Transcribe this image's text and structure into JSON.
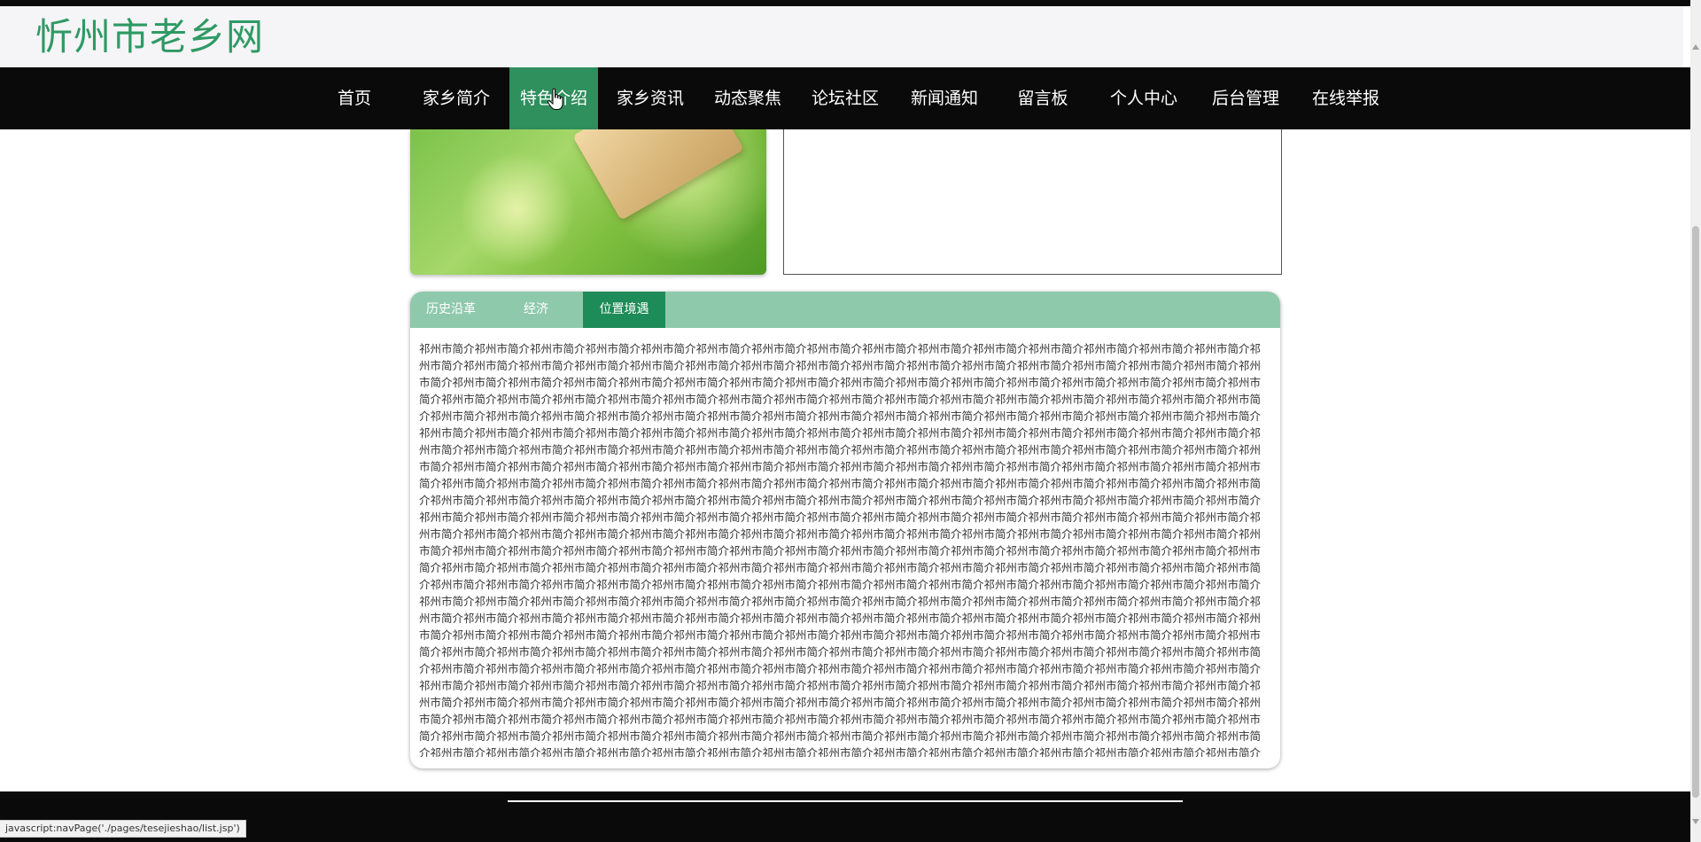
{
  "site": {
    "title": "忻州市老乡网"
  },
  "nav": {
    "items": [
      {
        "label": "首页"
      },
      {
        "label": "家乡简介"
      },
      {
        "label": "特色介绍"
      },
      {
        "label": "家乡资讯"
      },
      {
        "label": "动态聚焦"
      },
      {
        "label": "论坛社区"
      },
      {
        "label": "新闻通知"
      },
      {
        "label": "留言板"
      },
      {
        "label": "个人中心"
      },
      {
        "label": "后台管理"
      },
      {
        "label": "在线举报"
      }
    ],
    "active_label": "特色介绍"
  },
  "tabs": {
    "items": [
      {
        "label": "历史沿革"
      },
      {
        "label": "经济"
      },
      {
        "label": "位置境遇"
      }
    ],
    "active_label": "位置境遇",
    "content": "祁州市简介祁州市简介祁州市简介祁州市简介祁州市简介祁州市简介祁州市简介祁州市简介祁州市简介祁州市简介祁州市简介祁州市简介祁州市简介祁州市简介祁州市简介祁州市简介祁州市简介祁州市简介祁州市简介祁州市简介祁州市简介祁州市简介祁州市简介祁州市简介祁州市简介祁州市简介祁州市简介祁州市简介祁州市简介祁州市简介祁州市简介祁州市简介祁州市简介祁州市简介祁州市简介祁州市简介祁州市简介祁州市简介祁州市简介祁州市简介祁州市简介祁州市简介祁州市简介祁州市简介祁州市简介祁州市简介祁州市简介祁州市简介祁州市简介祁州市简介祁州市简介祁州市简介祁州市简介祁州市简介祁州市简介祁州市简介祁州市简介祁州市简介祁州市简介祁州市简介祁州市简介祁州市简介祁州市简介祁州市简介祁州市简介祁州市简介祁州市简介祁州市简介祁州市简介祁州市简介祁州市简介祁州市简介祁州市简介祁州市简介祁州市简介祁州市简介祁州市简介祁州市简介祁州市简介祁州市简介祁州市简介祁州市简介祁州市简介祁州市简介祁州市简介祁州市简介祁州市简介祁州市简介祁州市简介祁州市简介祁州市简介祁州市简介祁州市简介祁州市简介祁州市简介祁州市简介祁州市简介祁州市简介祁州市简介祁州市简介祁州市简介祁州市简介祁州市简介祁州市简介祁州市简介祁州市简介祁州市简介祁州市简介祁州市简介祁州市简介祁州市简介祁州市简介祁州市简介祁州市简介祁州市简介祁州市简介祁州市简介祁州市简介祁州市简介祁州市简介祁州市简介祁州市简介祁州市简介祁州市简介祁州市简介祁州市简介祁州市简介祁州市简介祁州市简介祁州市简介祁州市简介祁州市简介祁州市简介祁州市简介祁州市简介祁州市简介祁州市简介祁州市简介祁州市简介祁州市简介祁州市简介祁州市简介祁州市简介祁州市简介祁州市简介祁州市简介祁州市简介祁州市简介祁州市简介祁州市简介祁州市简介祁州市简介祁州市简介祁州市简介祁州市简介祁州市简介祁州市简介祁州市简介祁州市简介祁州市简介祁州市简介祁州市简介祁州市简介祁州市简介祁州市简介祁州市简介祁州市简介祁州市简介祁州市简介祁州市简介祁州市简介祁州市简介祁州市简介祁州市简介祁州市简介祁州市简介祁州市简介祁州市简介祁州市简介祁州市简介祁州市简介祁州市简介祁州市简介祁州市简介祁州市简介祁州市简介祁州市简介祁州市简介祁州市简介祁州市简介祁州市简介祁州市简介祁州市简介祁州市简介祁州市简介祁州市简介祁州市简介祁州市简介祁州市简介祁州市简介祁州市简介祁州市简介祁州市简介祁州市简介祁州市简介祁州市简介祁州市简介祁州市简介祁州市简介祁州市简介祁州市简介祁州市简介祁州市简介祁州市简介祁州市简介祁州市简介祁州市简介祁州市简介祁州市简介祁州市简介祁州市简介祁州市简介祁州市简介祁州市简介祁州市简介祁州市简介祁州市简介祁州市简介祁州市简介祁州市简介祁州市简介祁州市简介祁州市简介祁州市简介祁州市简介祁州市简介祁州市简介祁州市简介祁州市简介祁州市简介祁州市简介祁州市简介祁州市简介祁州市简介祁州市简介祁州市简介祁州市简介祁州市简介祁州市简介祁州市简介祁州市简介祁州市简介祁州市简介祁州市简介祁州市简介祁州市简介祁州市简介祁州市简介祁州市简介祁州市简介祁州市简介祁州市简介祁州市简介祁州市简介祁州市简介祁州市简介祁州市简介祁州市简介祁州市简介祁州市简介祁州市简介祁州市简介祁州市简介祁州市简介祁州市简介祁州市简介祁州市简介祁州市简介祁州市简介祁州市简介祁州市简介祁州市简介祁州市简介祁州市简介祁州市简介祁州市简介祁州市简介祁州市简介祁州市简介祁州市简介祁州市简介祁州市简介祁州市简介祁州市简介祁州市简介祁州市简介祁州市简介祁州市简介祁州市简介祁州市简介祁州市简介祁州市简介祁州市简介祁州市简介祁州市简介祁州市简介祁州市简介祁州市简介祁州市简介祁州市简介祁州市简介祁州市简介祁州市简介祁州市简介祁州市简介祁州市简介祁州市简介祁州市简介祁州市简介祁州市简介祁州市简介祁州市简介祁州市简介祁州市简介祁州市简介祁州市简介祁州市简介祁州市简介祁州市简介祁州市简介祁州市简介祁州市简介祁州市简介祁州市简介祁州市简介祁州市简介祁州市简介祁州市简介祁州市简介祁州市简介祁州市简介祁州市简介祁州市简介祁州市简介祁州市简介祁州市简介祁州市简介祁州市简介祁州市简介祁州市简介祁州市简介祁州市简介祁州市简介祁州市简介祁州市简介祁州市简介祁州市简介祁州市简介祁州市简介祁州市简介祁州市简介祁州市简介祁州市简介祁州市简介祁州市简介祁州市简介祁州市简介祁州市简介祁州市简介祁州市简介祁州市简介祁州市简介祁州市简介祁州市简介祁州市简介祁州市简介祁州市简介祁州市简介祁州市简介祁州市简介祁州市简介祁州市简介祁州市简介祁州市简介祁州市简介祁州市简介祁州市简介祁州市简介祁州市简介祁州市简介祁州市简介祁州市简介祁州市简介祁州市简介祁州市简介祁州市简介祁州市简介祁州市简介祁州市简介祁州市简介祁州市简介祁州市简介祁州市简介祁州市简介祁州市简介祁州市简介祁州市简介祁州市简介祁州市简介祁州市简介祁州市简介"
  },
  "status_bar": {
    "text": "javascript:navPage('./pages/tesejieshao/list.jsp')"
  },
  "colors": {
    "brand_green": "#2e9a63",
    "nav_active": "#2f8f5d",
    "tab_bar": "#8fc9ab",
    "tab_active": "#1e8c58"
  }
}
